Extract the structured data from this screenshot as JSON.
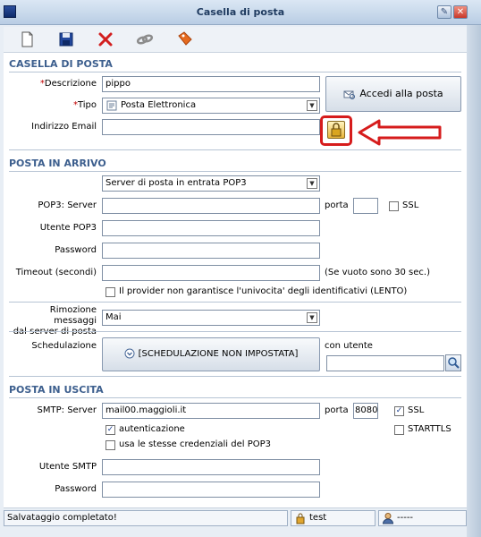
{
  "window": {
    "title": "Casella di posta"
  },
  "toolbar": {
    "new": "new-document",
    "save": "save-disk",
    "delete": "red-x",
    "link": "chain-link",
    "tag": "tag"
  },
  "casella": {
    "header": "CASELLA DI POSTA",
    "descrizione_label": "Descrizione",
    "descrizione_value": "pippo",
    "tipo_label": "Tipo",
    "tipo_value": "Posta Elettronica",
    "email_label": "Indirizzo Email",
    "email_value": "",
    "accedi_button": "Accedi alla posta",
    "required_mark": "*"
  },
  "arrivo": {
    "header": "POSTA IN ARRIVO",
    "server_type": "Server di posta in entrata POP3",
    "pop3_label": "POP3: Server",
    "pop3_value": "",
    "porta_label": "porta",
    "porta_value": "",
    "ssl_label": "SSL",
    "ssl_checked": false,
    "utente_label": "Utente POP3",
    "utente_value": "",
    "password_label": "Password",
    "password_value": "",
    "timeout_label": "Timeout (secondi)",
    "timeout_value": "",
    "timeout_note": "(Se vuoto sono 30 sec.)",
    "provider_check": "Il provider non garantisce l'univocita' degli identificativi (LENTO)",
    "rimozione_label_1": "Rimozione messaggi",
    "rimozione_label_2": "dal server di posta",
    "rimozione_value": "Mai",
    "sched_label": "Schedulazione",
    "sched_button": "[SCHEDULAZIONE NON IMPOSTATA]",
    "con_utente_label": "con utente",
    "con_utente_value": ""
  },
  "uscita": {
    "header": "POSTA IN USCITA",
    "smtp_label": "SMTP: Server",
    "smtp_value": "mail00.maggioli.it",
    "porta_label": "porta",
    "porta_value": "8080",
    "ssl_label": "SSL",
    "ssl_checked": true,
    "starttls_label": "STARTTLS",
    "starttls_checked": false,
    "autenticazione_label": "autenticazione",
    "autenticazione_checked": true,
    "stesse_label": "usa le stesse credenziali del POP3",
    "stesse_checked": false,
    "utente_label": "Utente SMTP",
    "utente_value": "",
    "password_label": "Password",
    "password_value": ""
  },
  "status": {
    "message": "Salvataggio completato!",
    "user": "test",
    "other": "-----"
  },
  "colors": {
    "section": "#3d5f8e",
    "annotation": "#d61c1c"
  }
}
